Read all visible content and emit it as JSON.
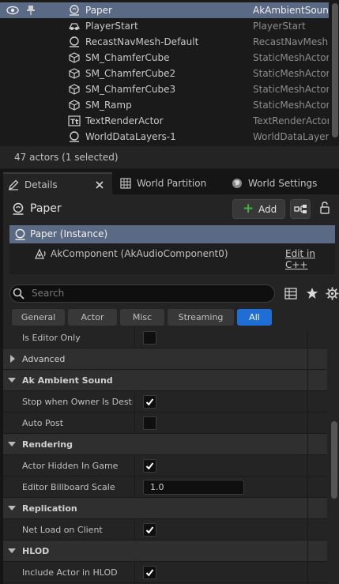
{
  "outliner": {
    "rows": [
      {
        "name": "Paper",
        "type": "AkAmbientSound",
        "icon": "ambient-sound-icon"
      },
      {
        "name": "PlayerStart",
        "type": "PlayerStart",
        "icon": "player-start-icon"
      },
      {
        "name": "RecastNavMesh-Default",
        "type": "RecastNavMesh",
        "icon": "navmesh-icon"
      },
      {
        "name": "SM_ChamferCube",
        "type": "StaticMeshActor",
        "icon": "static-mesh-icon"
      },
      {
        "name": "SM_ChamferCube2",
        "type": "StaticMeshActor",
        "icon": "static-mesh-icon"
      },
      {
        "name": "SM_ChamferCube3",
        "type": "StaticMeshActor",
        "icon": "static-mesh-icon"
      },
      {
        "name": "SM_Ramp",
        "type": "StaticMeshActor",
        "icon": "static-mesh-icon"
      },
      {
        "name": "TextRenderActor",
        "type": "TextRenderActor",
        "icon": "text-render-icon"
      },
      {
        "name": "WorldDataLayers-1",
        "type": "WorldDataLayers",
        "icon": "world-data-layers-icon"
      }
    ],
    "footer": "47 actors (1 selected)"
  },
  "tabs": {
    "details": "Details",
    "world_partition": "World Partition",
    "world_settings": "World Settings"
  },
  "details": {
    "actor_name": "Paper",
    "add_label": "Add",
    "components": {
      "root": "Paper (Instance)",
      "child": "AkComponent (AkAudioComponent0)",
      "edit_link": "Edit in C++"
    },
    "search_placeholder": "Search",
    "filters": [
      "General",
      "Actor",
      "Misc",
      "Streaming",
      "All"
    ],
    "active_filter": "All",
    "properties": {
      "is_editor_only": "Is Editor Only",
      "advanced": "Advanced",
      "cat_ak": "Ak Ambient Sound",
      "stop_when_owner": "Stop when Owner Is Destroyed",
      "auto_post": "Auto Post",
      "cat_rendering": "Rendering",
      "actor_hidden": "Actor Hidden In Game",
      "billboard_scale": "Editor Billboard Scale",
      "billboard_scale_value": "1.0",
      "cat_replication": "Replication",
      "net_load": "Net Load on Client",
      "cat_hlod": "HLOD",
      "include_hlod": "Include Actor in HLOD"
    }
  },
  "colors": {
    "selection": "#5a6a84",
    "accent_blue": "#1e6ed6",
    "add_green": "#3fb33f"
  }
}
